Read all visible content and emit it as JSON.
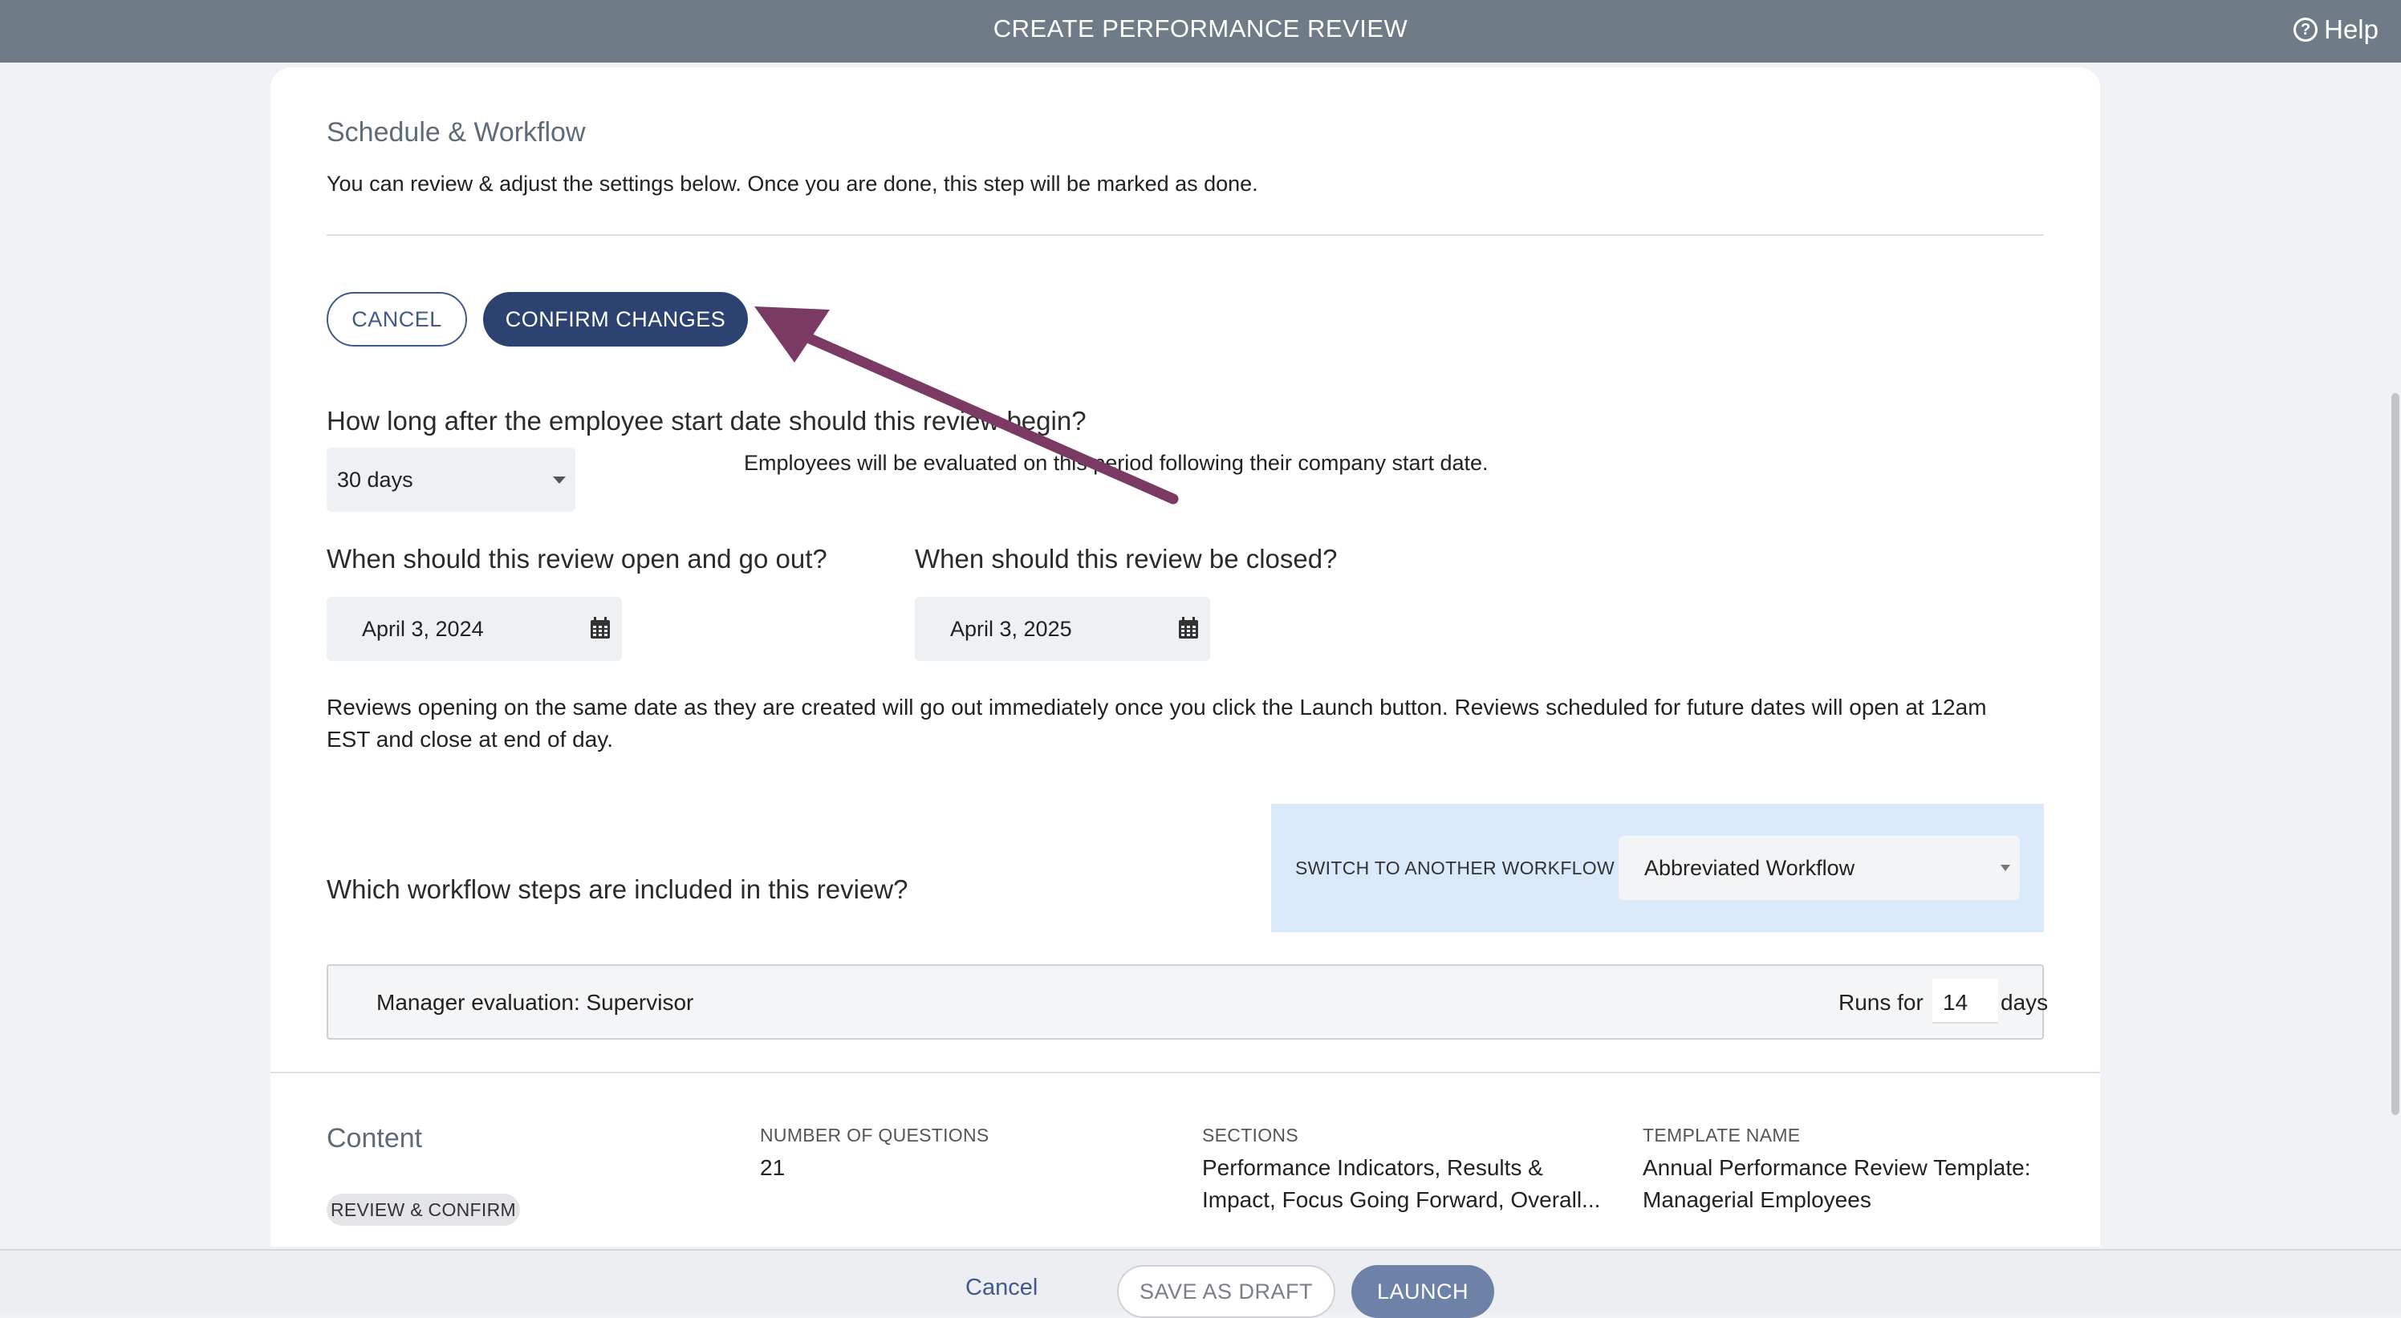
{
  "header": {
    "title": "CREATE PERFORMANCE REVIEW",
    "help_label": "Help",
    "help_icon": "?"
  },
  "schedule": {
    "title": "Schedule & Workflow",
    "intro": "You can review & adjust the settings below. Once you are done, this step will be marked as done.",
    "cancel_label": "CANCEL",
    "confirm_label": "CONFIRM CHANGES",
    "start_question": "How long after the employee start date should this review begin?",
    "start_value": "30 days",
    "start_help": "Employees will be evaluated on this period following their company start date.",
    "open_question": "When should this review open and go out?",
    "open_date": "April 3, 2024",
    "close_question": "When should this review be closed?",
    "close_date": "April 3, 2025",
    "note_line1": "Reviews opening on the same date as they are created will go out immediately once you click the Launch button. Reviews scheduled for future dates will open at 12am",
    "note_line2": "EST and close at end of day.",
    "workflow_question": "Which workflow steps are included in this review?",
    "switch_label": "SWITCH TO ANOTHER WORKFLOW",
    "workflow_value": "Abbreviated Workflow",
    "step_name": "Manager evaluation: Supervisor",
    "runs_for_label": "Runs for",
    "runs_for_value": "14",
    "days_label": "days"
  },
  "content": {
    "title": "Content",
    "badge": "REVIEW & CONFIRM",
    "questions_label": "NUMBER OF QUESTIONS",
    "questions_value": "21",
    "sections_label": "SECTIONS",
    "sections_line1": "Performance Indicators, Results &",
    "sections_line2": "Impact, Focus Going Forward, Overall...",
    "template_label": "TEMPLATE NAME",
    "template_line1": "Annual Performance Review Template:",
    "template_line2": "Managerial Employees"
  },
  "footer": {
    "cancel_label": "Cancel",
    "draft_label": "SAVE AS DRAFT",
    "launch_label": "LAUNCH"
  },
  "colors": {
    "header_bg": "#6f7c87",
    "primary": "#2c4371",
    "arrow": "#7a3a63",
    "launch": "#6e82a8",
    "workflow_bg": "#dbeafa"
  }
}
